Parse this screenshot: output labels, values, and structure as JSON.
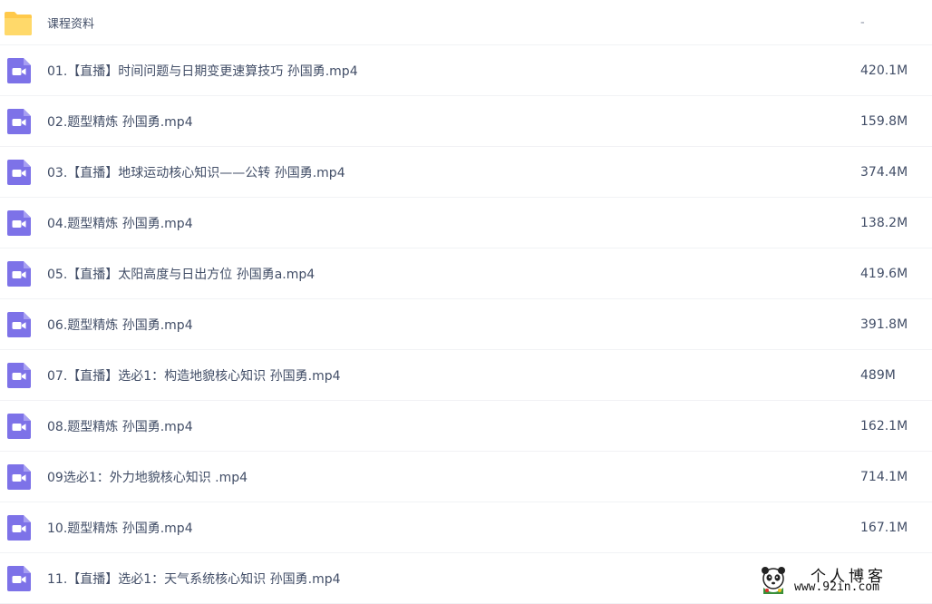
{
  "files": [
    {
      "type": "folder",
      "icon": "folder-icon",
      "name": "课程资料",
      "size": "-"
    },
    {
      "type": "video",
      "icon": "video-file-icon",
      "name": "01.【直播】时间问题与日期变更速算技巧 孙国勇.mp4",
      "size": "420.1M"
    },
    {
      "type": "video",
      "icon": "video-file-icon",
      "name": "02.题型精炼 孙国勇.mp4",
      "size": "159.8M"
    },
    {
      "type": "video",
      "icon": "video-file-icon",
      "name": "03.【直播】地球运动核心知识——公转 孙国勇.mp4",
      "size": "374.4M"
    },
    {
      "type": "video",
      "icon": "video-file-icon",
      "name": "04.题型精炼 孙国勇.mp4",
      "size": "138.2M"
    },
    {
      "type": "video",
      "icon": "video-file-icon",
      "name": "05.【直播】太阳高度与日出方位 孙国勇a.mp4",
      "size": "419.6M"
    },
    {
      "type": "video",
      "icon": "video-file-icon",
      "name": "06.题型精炼 孙国勇.mp4",
      "size": "391.8M"
    },
    {
      "type": "video",
      "icon": "video-file-icon",
      "name": "07.【直播】选必1：构造地貌核心知识 孙国勇.mp4",
      "size": "489M"
    },
    {
      "type": "video",
      "icon": "video-file-icon",
      "name": "08.题型精炼 孙国勇.mp4",
      "size": "162.1M"
    },
    {
      "type": "video",
      "icon": "video-file-icon",
      "name": "09选必1：外力地貌核心知识 .mp4",
      "size": "714.1M"
    },
    {
      "type": "video",
      "icon": "video-file-icon",
      "name": "10.题型精炼 孙国勇.mp4",
      "size": "167.1M"
    },
    {
      "type": "video",
      "icon": "video-file-icon",
      "name": "11.【直播】选必1：天气系统核心知识 孙国勇.mp4",
      "size": ""
    }
  ],
  "watermark": {
    "mascot_icon": "panda-mascot-icon",
    "title": "个人博客",
    "url": "www.92in.com"
  },
  "colors": {
    "folder": "#ffc94a",
    "folder_tab": "#ffd96a",
    "video_icon": "#7d72e8",
    "text": "#424e67",
    "row_divider": "#f1f2f5"
  }
}
